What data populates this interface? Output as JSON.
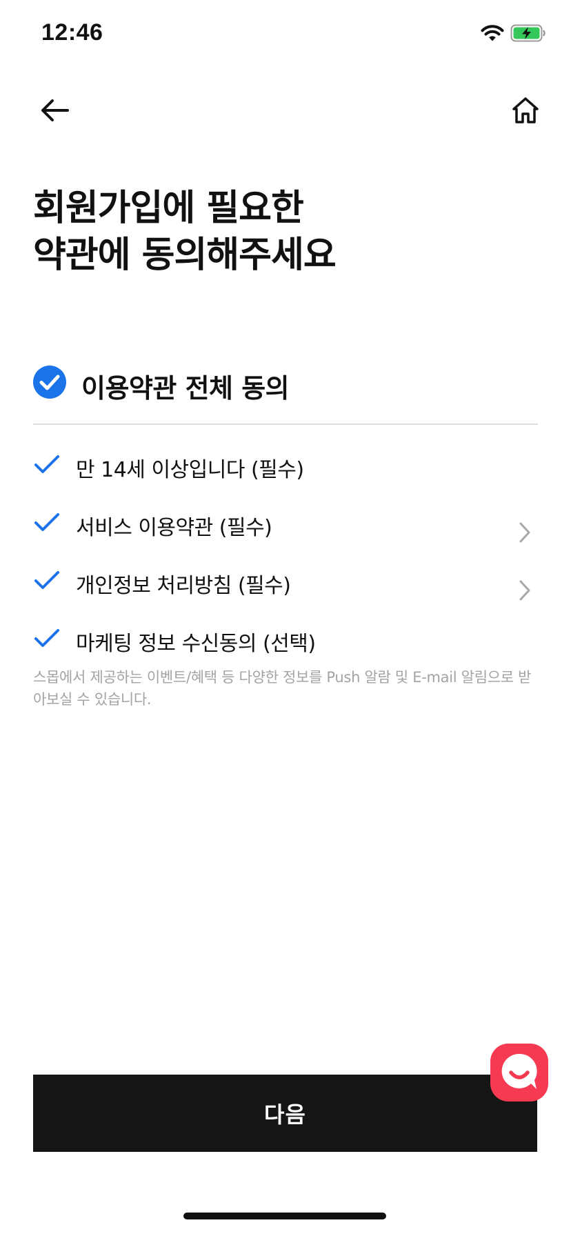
{
  "status_bar": {
    "time": "12:46",
    "wifi_icon": "wifi-icon",
    "battery_icon": "battery-charging-icon"
  },
  "nav": {
    "back_icon": "arrow-left-icon",
    "home_icon": "home-icon"
  },
  "page": {
    "title": "회원가입에 필요한\n약관에 동의해주세요"
  },
  "agree_all": {
    "label": "이용약관 전체 동의",
    "checked": true,
    "accent_color": "#1a73e8"
  },
  "terms": [
    {
      "label": "만 14세 이상입니다 (필수)",
      "checked": true,
      "has_detail": false
    },
    {
      "label": "서비스 이용약관 (필수)",
      "checked": true,
      "has_detail": true
    },
    {
      "label": "개인정보 처리방침 (필수)",
      "checked": true,
      "has_detail": true
    },
    {
      "label": "마케팅 정보 수신동의 (선택)",
      "checked": true,
      "has_detail": false
    }
  ],
  "marketing_description": "스몹에서 제공하는 이벤트/혜택 등 다양한 정보를 Push 알람 및 E-mail 알림으로 받아보실 수 있습니다.",
  "next_button": {
    "label": "다음",
    "background": "#151515"
  },
  "chat_fab": {
    "icon": "chat-smile-icon",
    "color": "#f53a52"
  }
}
